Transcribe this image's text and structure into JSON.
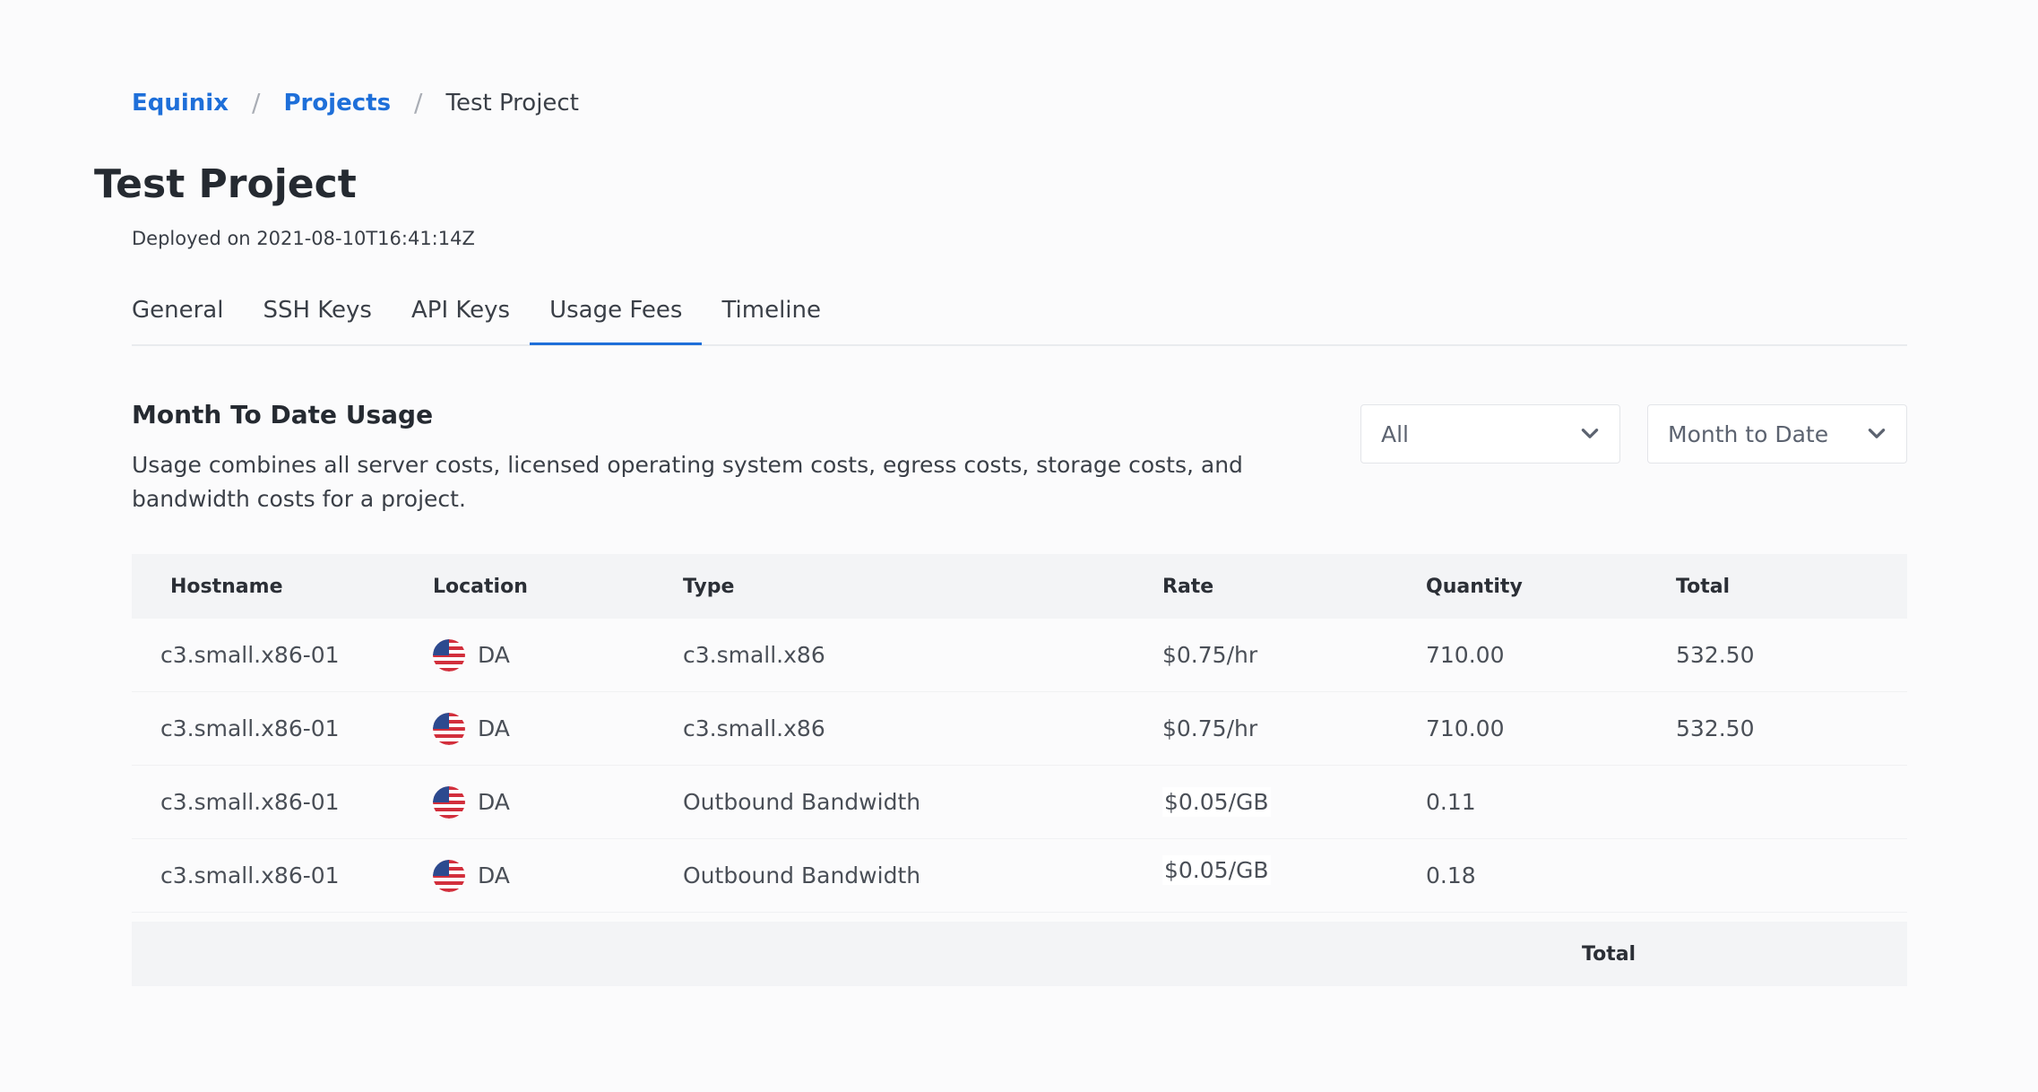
{
  "breadcrumb": {
    "items": [
      "Equinix",
      "Projects"
    ],
    "separator": "/",
    "current": "Test Project"
  },
  "project": {
    "title": "Test Project",
    "deployed": "Deployed on 2021-08-10T16:41:14Z"
  },
  "tabs": [
    {
      "label": "General",
      "active": false
    },
    {
      "label": "SSH Keys",
      "active": false
    },
    {
      "label": "API Keys",
      "active": false
    },
    {
      "label": "Usage Fees",
      "active": true
    },
    {
      "label": "Timeline",
      "active": false
    }
  ],
  "usage": {
    "title": "Month To Date Usage",
    "description": "Usage combines all server costs, licensed operating system costs, egress costs, storage costs, and bandwidth costs for a project.",
    "filter_type": {
      "selected": "All",
      "icon": "chevron-down-icon"
    },
    "filter_period": {
      "selected": "Month to Date",
      "icon": "chevron-down-icon"
    }
  },
  "table": {
    "headers": {
      "hostname": "Hostname",
      "location": "Location",
      "type": "Type",
      "rate": "Rate",
      "quantity": "Quantity",
      "total": "Total"
    },
    "rows": [
      {
        "hostname": "c3.small.x86-01",
        "flag": "us-flag-icon",
        "location": "DA",
        "type": "c3.small.x86",
        "rate": "$0.75/hr",
        "quantity": "710.00",
        "total": "532.50"
      },
      {
        "hostname": "c3.small.x86-01",
        "flag": "us-flag-icon",
        "location": "DA",
        "type": "c3.small.x86",
        "rate": "$0.75/hr",
        "quantity": "710.00",
        "total": "532.50"
      },
      {
        "hostname": "c3.small.x86-01",
        "flag": "us-flag-icon",
        "location": "DA",
        "type": "Outbound Bandwidth",
        "rate": "$0.05/GB",
        "quantity": "0.11",
        "total": ""
      },
      {
        "hostname": "c3.small.x86-01",
        "flag": "us-flag-icon",
        "location": "DA",
        "type": "Outbound Bandwidth",
        "rate": "$0.05/GB",
        "quantity": "0.18",
        "total": ""
      }
    ],
    "footer": {
      "label": "Total"
    }
  },
  "colors": {
    "link": "#1e6fd9",
    "tab_active_underline": "#1e6fd9",
    "header_bg": "#f3f4f6",
    "page_bg": "#fbfbfc"
  }
}
